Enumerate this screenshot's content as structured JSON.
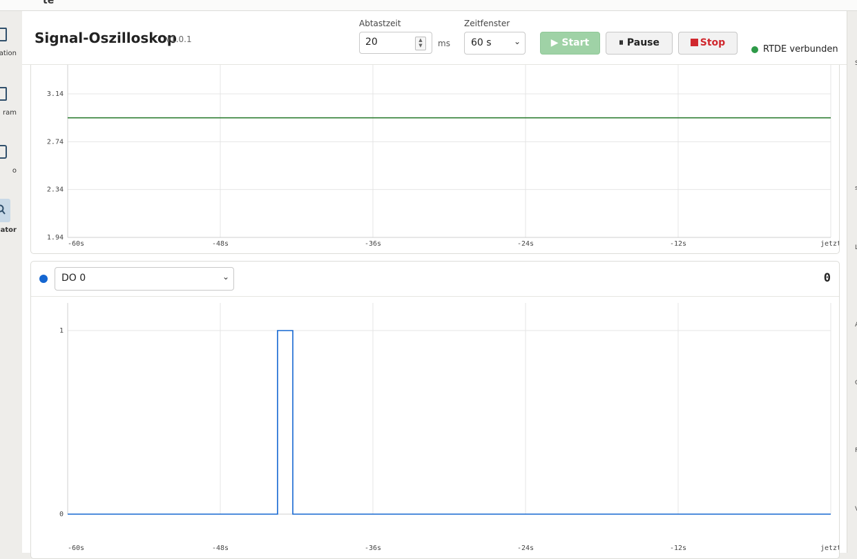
{
  "window": {
    "top_label": "te"
  },
  "nav": {
    "items": [
      {
        "label": "ation",
        "icon": "layout-icon"
      },
      {
        "label": "ram",
        "icon": "program-icon"
      },
      {
        "label": "o",
        "icon": "cube-icon"
      },
      {
        "label": "ator",
        "icon": "search-icon",
        "active": true
      }
    ]
  },
  "header": {
    "title": "Signal-Oszilloskop",
    "version": "v1.0.1",
    "sample_label": "Abtastzeit",
    "sample_value": "20",
    "sample_unit": "ms",
    "window_label": "Zeitfenster",
    "window_value": "60 s",
    "start_label": "▶ Start",
    "pause_label": "⏸ Pause",
    "stop_label": "Stop",
    "status_text": "RTDE verbunden",
    "status_color": "#2e9a48"
  },
  "rightbar": {
    "marks": [
      "S",
      "s",
      "L",
      "A",
      "C",
      "F",
      "V"
    ]
  },
  "chart_data": [
    {
      "type": "line",
      "color": "#2e7d32",
      "x": [
        "-60s",
        "-48s",
        "-36s",
        "-24s",
        "-12s",
        "jetzt"
      ],
      "y_ticks": [
        "3.14",
        "2.74",
        "2.34",
        "1.94"
      ],
      "ylim": [
        1.94,
        3.14
      ],
      "series": [
        {
          "values": [
            [
              -60,
              2.94
            ],
            [
              0,
              2.94
            ]
          ]
        }
      ],
      "grid": true
    },
    {
      "type": "line",
      "signal": "DO 0",
      "current_value": "0",
      "color": "#1466d1",
      "x": [
        "-60s",
        "-48s",
        "-36s",
        "-24s",
        "-12s",
        "jetzt"
      ],
      "y_ticks": [
        "1",
        "0"
      ],
      "ylim": [
        0,
        1
      ],
      "series": [
        {
          "values": [
            [
              -60,
              0
            ],
            [
              -43.5,
              0
            ],
            [
              -43.5,
              1
            ],
            [
              -42.3,
              1
            ],
            [
              -42.3,
              0
            ],
            [
              0,
              0
            ]
          ]
        }
      ],
      "grid": true
    }
  ]
}
